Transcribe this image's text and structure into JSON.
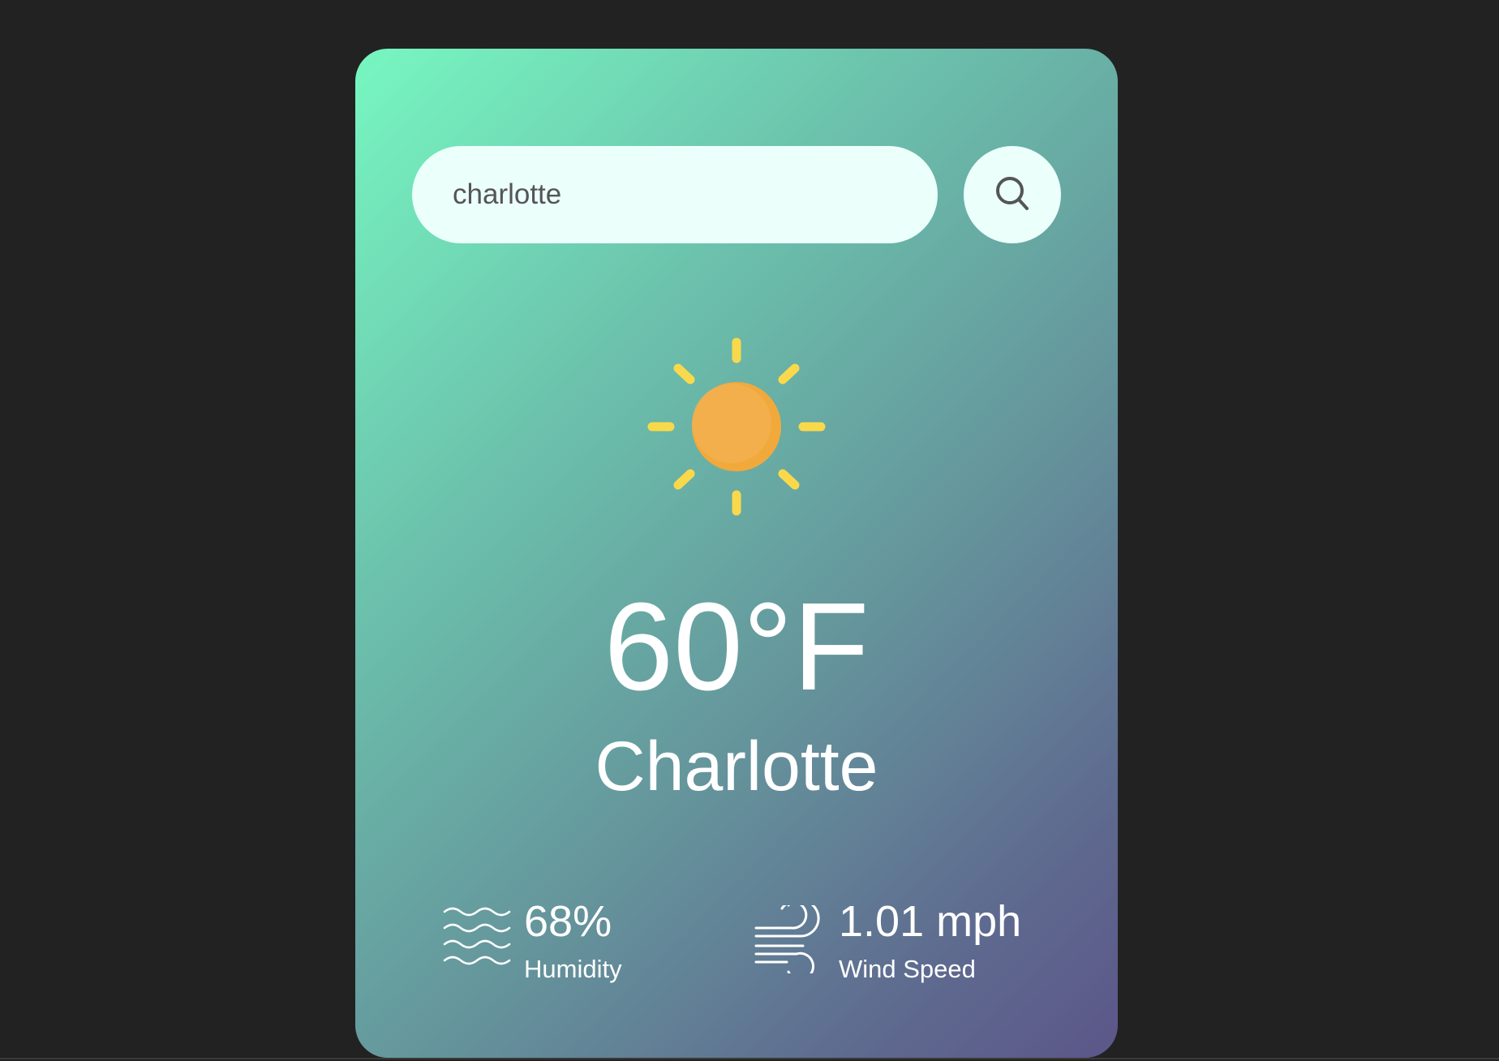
{
  "search": {
    "value": "charlotte",
    "button_icon": "search-icon"
  },
  "weather": {
    "icon": "sun-icon",
    "temperature": "60°F",
    "city": "Charlotte"
  },
  "details": {
    "humidity": {
      "icon": "humidity-waves-icon",
      "value": "68%",
      "label": "Humidity"
    },
    "wind": {
      "icon": "wind-icon",
      "value": "1.01 mph",
      "label": "Wind Speed"
    }
  },
  "colors": {
    "background": "#222222",
    "card_gradient_start": "#77f7c1",
    "card_gradient_end": "#5c5689",
    "input_background": "#ebfffb",
    "sun_core": "#f2a93b",
    "sun_rays": "#f9d94b",
    "text": "#ffffff"
  }
}
